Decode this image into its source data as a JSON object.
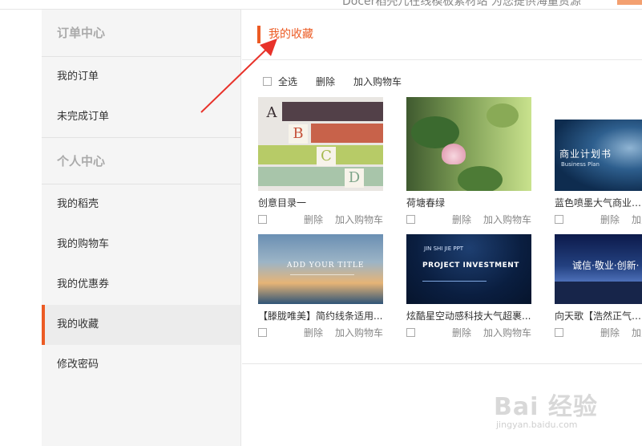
{
  "top_banner": {
    "text": "Docer稻壳儿在线模板素材站   为您提供海量资源"
  },
  "sidebar": {
    "sections": [
      {
        "label": "订单中心",
        "items": [
          "我的订单",
          "未完成订单"
        ]
      },
      {
        "label": "个人中心",
        "items": [
          "我的稻壳",
          "我的购物车",
          "我的优惠券",
          "我的收藏",
          "修改密码"
        ]
      }
    ],
    "active_item": "我的收藏"
  },
  "main": {
    "title": "我的收藏",
    "toolbar": {
      "select_all": "全选",
      "delete": "删除",
      "add_to_cart": "加入购物车"
    },
    "cards": [
      {
        "title": "创意目录一",
        "delete": "删除",
        "add_to_cart": "加入购物车"
      },
      {
        "title": "荷塘春绿",
        "delete": "删除",
        "add_to_cart": "加入购物车"
      },
      {
        "title": "蓝色喷墨大气商业计划书",
        "delete": "删除",
        "add_to_cart": "加入购物车"
      },
      {
        "title": "【滕胧唯美】简约线条适用...",
        "delete": "删除",
        "add_to_cart": "加入购物车"
      },
      {
        "title": "炫酷星空动感科技大气超裹...",
        "delete": "删除",
        "add_to_cart": "加入购物车"
      },
      {
        "title": "向天歌【浩然正气】企业文化",
        "delete": "删除",
        "add_to_cart": "加入购物车"
      }
    ],
    "thumbnails": {
      "t1_letters": [
        "A",
        "B",
        "C",
        "D"
      ],
      "t3_title": "商业计划书",
      "t3_sub": "Business Plan",
      "t4_title": "ADD YOUR TITLE",
      "t5_top": "JIN SHI JIE PPT",
      "t5_title": "PROJECT INVESTMENT",
      "t6_title": "诚信·敬业·创新·"
    }
  },
  "watermark": {
    "logo": "Bai 经验",
    "url": "jingyan.baidu.com"
  },
  "colors": {
    "accent": "#ec5b24",
    "annotation": "#e8322a"
  }
}
